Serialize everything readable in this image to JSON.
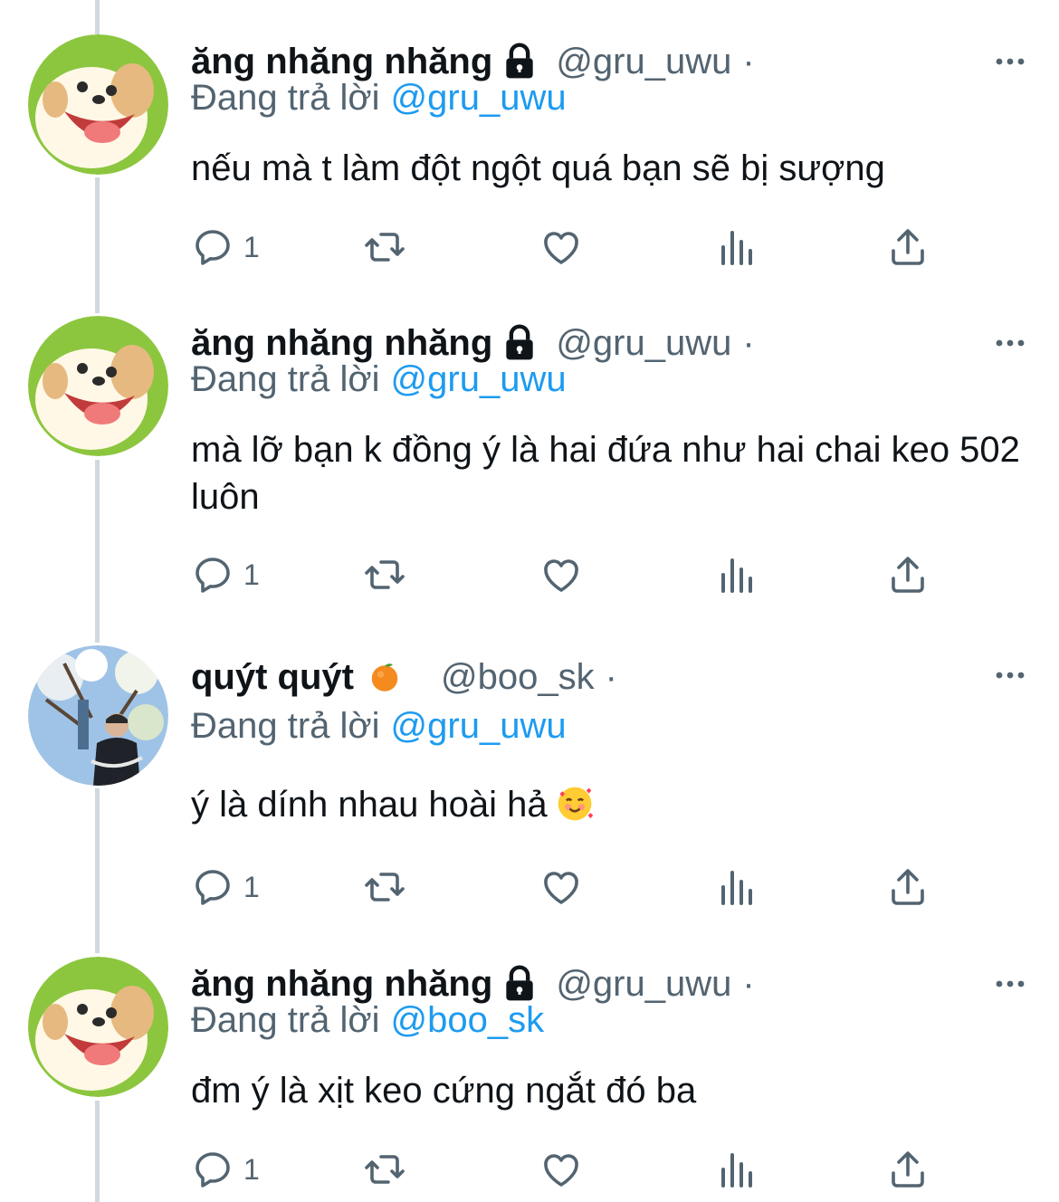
{
  "tweets": [
    {
      "name": "ăng nhăng nhăng",
      "handle": "@gru_uwu",
      "dot": "·",
      "replying_prefix": "Đang trả lời",
      "replying_to": "@gru_uwu",
      "text": "nếu mà t làm đột ngột quá bạn sẽ bị sượng",
      "reply_count": "1",
      "avatar": "dog-avatar",
      "badge": "lock-icon"
    },
    {
      "name": "ăng nhăng nhăng",
      "handle": "@gru_uwu",
      "dot": "·",
      "replying_prefix": "Đang trả lời",
      "replying_to": "@gru_uwu",
      "text": "mà lỡ bạn k đồng ý là hai đứa như hai chai keo 502 luôn",
      "reply_count": "1",
      "avatar": "dog-avatar",
      "badge": "lock-icon"
    },
    {
      "name": "quýt quýt",
      "handle": "@boo_sk",
      "dot": "·",
      "replying_prefix": "Đang trả lời",
      "replying_to": "@gru_uwu",
      "text": "ý là dính nhau hoài hả",
      "reply_count": "1",
      "avatar": "photo-avatar",
      "badge": "tangerine-emoji",
      "trailing_emoji": "smiling-face-with-hearts-emoji"
    },
    {
      "name": "ăng nhăng nhăng",
      "handle": "@gru_uwu",
      "dot": "·",
      "replying_prefix": "Đang trả lời",
      "replying_to": "@boo_sk",
      "text": "đm ý là xịt keo cứng ngắt đó ba",
      "reply_count": "1",
      "avatar": "dog-avatar",
      "badge": "lock-icon"
    }
  ],
  "colors": {
    "text": "#0f1419",
    "secondary": "#536471",
    "link": "#1d9bf0",
    "thread_line": "#cfd9de",
    "avatar_green": "#8cc63f"
  },
  "action_icons": [
    "reply-icon",
    "retweet-icon",
    "like-icon",
    "analytics-icon",
    "share-icon"
  ]
}
